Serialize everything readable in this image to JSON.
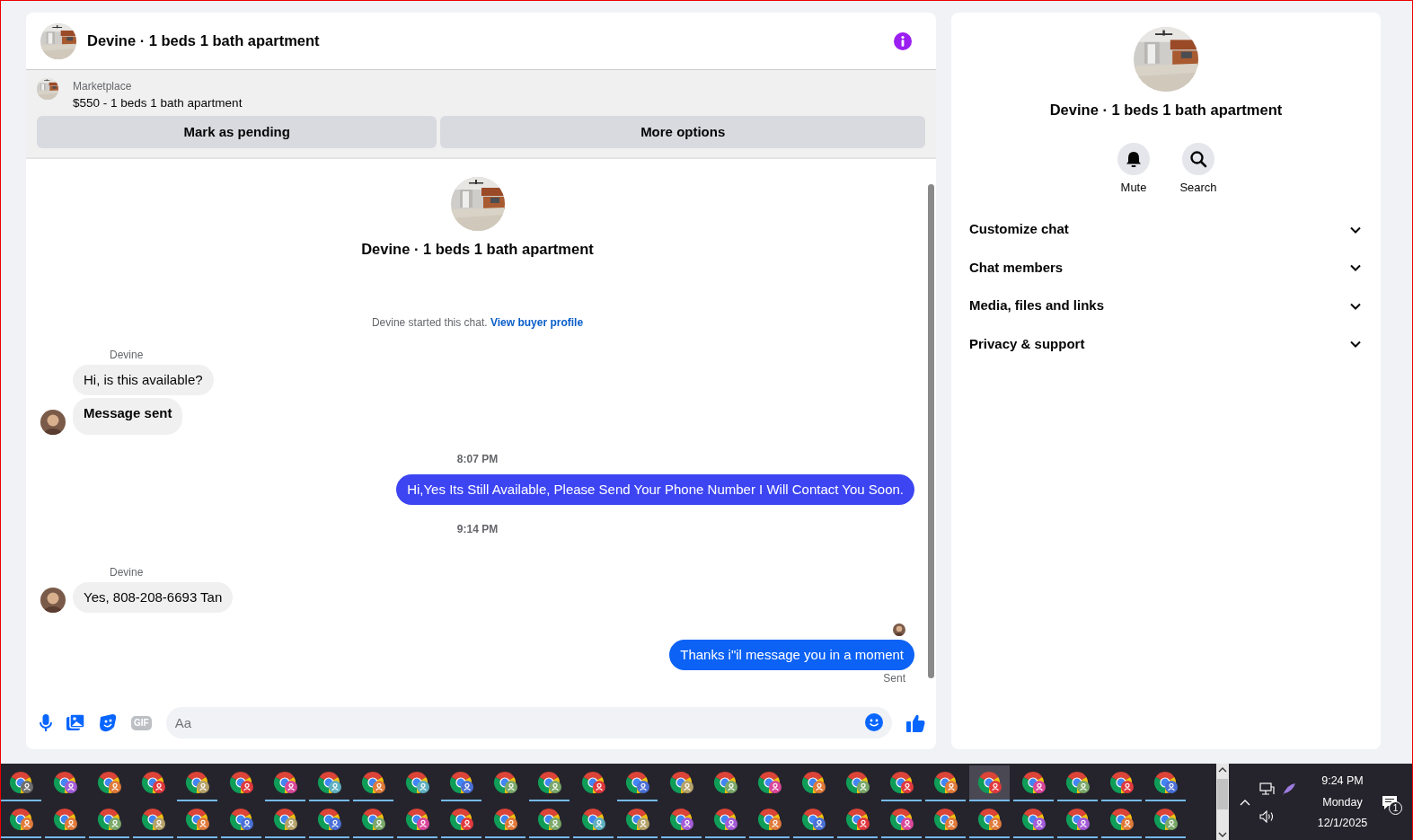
{
  "chat": {
    "title": "Devine · 1 beds 1 bath apartment",
    "listing": {
      "source": "Marketplace",
      "title": "$550 - 1 beds 1 bath apartment"
    },
    "actions": [
      "Mark as pending",
      "More options"
    ],
    "intro": {
      "title": "Devine · 1 beds 1 bath apartment",
      "notice": "Devine started this chat.",
      "link": "View buyer profile"
    },
    "messages": [
      {
        "kind": "sender",
        "text": "Devine"
      },
      {
        "kind": "incoming",
        "text": "Hi, is this available?",
        "avatar": false,
        "bold": false
      },
      {
        "kind": "incoming",
        "text": "Message sent",
        "avatar": true,
        "bold": true
      },
      {
        "kind": "time",
        "text": "8:07 PM"
      },
      {
        "kind": "outgoing",
        "text": "Hi,Yes Its Still Available, Please Send Your Phone Number I Will Contact You Soon.",
        "color": "#3d45f2"
      },
      {
        "kind": "time",
        "text": "9:14 PM"
      },
      {
        "kind": "sender",
        "text": "Devine"
      },
      {
        "kind": "incoming",
        "text": "Yes, 808-208-6693 Tan",
        "avatar": true,
        "bold": false
      },
      {
        "kind": "seen"
      },
      {
        "kind": "outgoing",
        "text": "Thanks i\"il message you in a moment",
        "color": "#0b62f5"
      },
      {
        "kind": "status",
        "text": "Sent"
      }
    ],
    "composer": {
      "placeholder": "Aa",
      "gif": "GIF"
    }
  },
  "details": {
    "title": "Devine · 1 beds 1 bath apartment",
    "actions": [
      {
        "kind": "mute",
        "label": "Mute"
      },
      {
        "kind": "search",
        "label": "Search"
      }
    ],
    "sections": [
      {
        "label": "Customize chat",
        "expanded": false
      },
      {
        "label": "Chat members",
        "expanded": false
      },
      {
        "label": "Media, files and links",
        "expanded": false
      },
      {
        "label": "Privacy & support",
        "expanded": false
      }
    ]
  },
  "taskbar": {
    "rows": [
      [
        {
          "color": "#6e6e6e",
          "running": true,
          "selected": false
        },
        {
          "color": "#a35bd6",
          "running": false,
          "selected": false
        },
        {
          "color": "#e07a3a",
          "running": false,
          "selected": false
        },
        {
          "color": "#e0393e",
          "running": false,
          "selected": false
        },
        {
          "color": "#b5a26a",
          "running": true,
          "selected": false
        },
        {
          "color": "#e0393e",
          "running": false,
          "selected": false
        },
        {
          "color": "#d9479a",
          "running": true,
          "selected": false
        },
        {
          "color": "#5fb0c0",
          "running": true,
          "selected": false
        },
        {
          "color": "#e07a3a",
          "running": true,
          "selected": false
        },
        {
          "color": "#5fb0c0",
          "running": false,
          "selected": false
        },
        {
          "color": "#4a6fd6",
          "running": true,
          "selected": false
        },
        {
          "color": "#7aa86a",
          "running": false,
          "selected": false
        },
        {
          "color": "#7aa86a",
          "running": true,
          "selected": false
        },
        {
          "color": "#e0393e",
          "running": false,
          "selected": false
        },
        {
          "color": "#4a6fd6",
          "running": true,
          "selected": false
        },
        {
          "color": "#b5a26a",
          "running": false,
          "selected": false
        },
        {
          "color": "#7aa86a",
          "running": false,
          "selected": false
        },
        {
          "color": "#d9479a",
          "running": false,
          "selected": false
        },
        {
          "color": "#e07a3a",
          "running": false,
          "selected": false
        },
        {
          "color": "#7aa86a",
          "running": false,
          "selected": false
        },
        {
          "color": "#e0393e",
          "running": true,
          "selected": false
        },
        {
          "color": "#e07a3a",
          "running": true,
          "selected": false
        },
        {
          "color": "#e0393e",
          "running": true,
          "selected": true
        },
        {
          "color": "#d9479a",
          "running": true,
          "selected": false
        },
        {
          "color": "#7aa86a",
          "running": true,
          "selected": false
        },
        {
          "color": "#e0393e",
          "running": true,
          "selected": false
        },
        {
          "color": "#4a6fd6",
          "running": true,
          "selected": false
        }
      ],
      [
        {
          "color": "#e07a3a",
          "running": true,
          "selected": false
        },
        {
          "color": "#e07a3a",
          "running": true,
          "selected": false
        },
        {
          "color": "#7aa86a",
          "running": true,
          "selected": false
        },
        {
          "color": "#b5a26a",
          "running": true,
          "selected": false
        },
        {
          "color": "#e07a3a",
          "running": true,
          "selected": false
        },
        {
          "color": "#4a6fd6",
          "running": true,
          "selected": false
        },
        {
          "color": "#b5a26a",
          "running": true,
          "selected": false
        },
        {
          "color": "#4a6fd6",
          "running": true,
          "selected": false
        },
        {
          "color": "#7aa86a",
          "running": true,
          "selected": false
        },
        {
          "color": "#d9479a",
          "running": true,
          "selected": false
        },
        {
          "color": "#e0393e",
          "running": true,
          "selected": false
        },
        {
          "color": "#e07a3a",
          "running": true,
          "selected": false
        },
        {
          "color": "#7aa86a",
          "running": true,
          "selected": false
        },
        {
          "color": "#5fb0c0",
          "running": true,
          "selected": false
        },
        {
          "color": "#b5a26a",
          "running": true,
          "selected": false
        },
        {
          "color": "#a35bd6",
          "running": true,
          "selected": false
        },
        {
          "color": "#a35bd6",
          "running": true,
          "selected": false
        },
        {
          "color": "#e07a3a",
          "running": true,
          "selected": false
        },
        {
          "color": "#4a6fd6",
          "running": true,
          "selected": false
        },
        {
          "color": "#e0393e",
          "running": true,
          "selected": false
        },
        {
          "color": "#d9479a",
          "running": true,
          "selected": false
        },
        {
          "color": "#e07a3a",
          "running": true,
          "selected": false
        },
        {
          "color": "#e07a3a",
          "running": true,
          "selected": false
        },
        {
          "color": "#a35bd6",
          "running": true,
          "selected": false
        },
        {
          "color": "#a35bd6",
          "running": true,
          "selected": false
        },
        {
          "color": "#e07a3a",
          "running": true,
          "selected": false
        },
        {
          "color": "#7aa86a",
          "running": true,
          "selected": false
        }
      ]
    ],
    "clock": {
      "time": "9:24 PM",
      "day": "Monday",
      "date": "12/1/2025"
    },
    "notifications": "1"
  }
}
